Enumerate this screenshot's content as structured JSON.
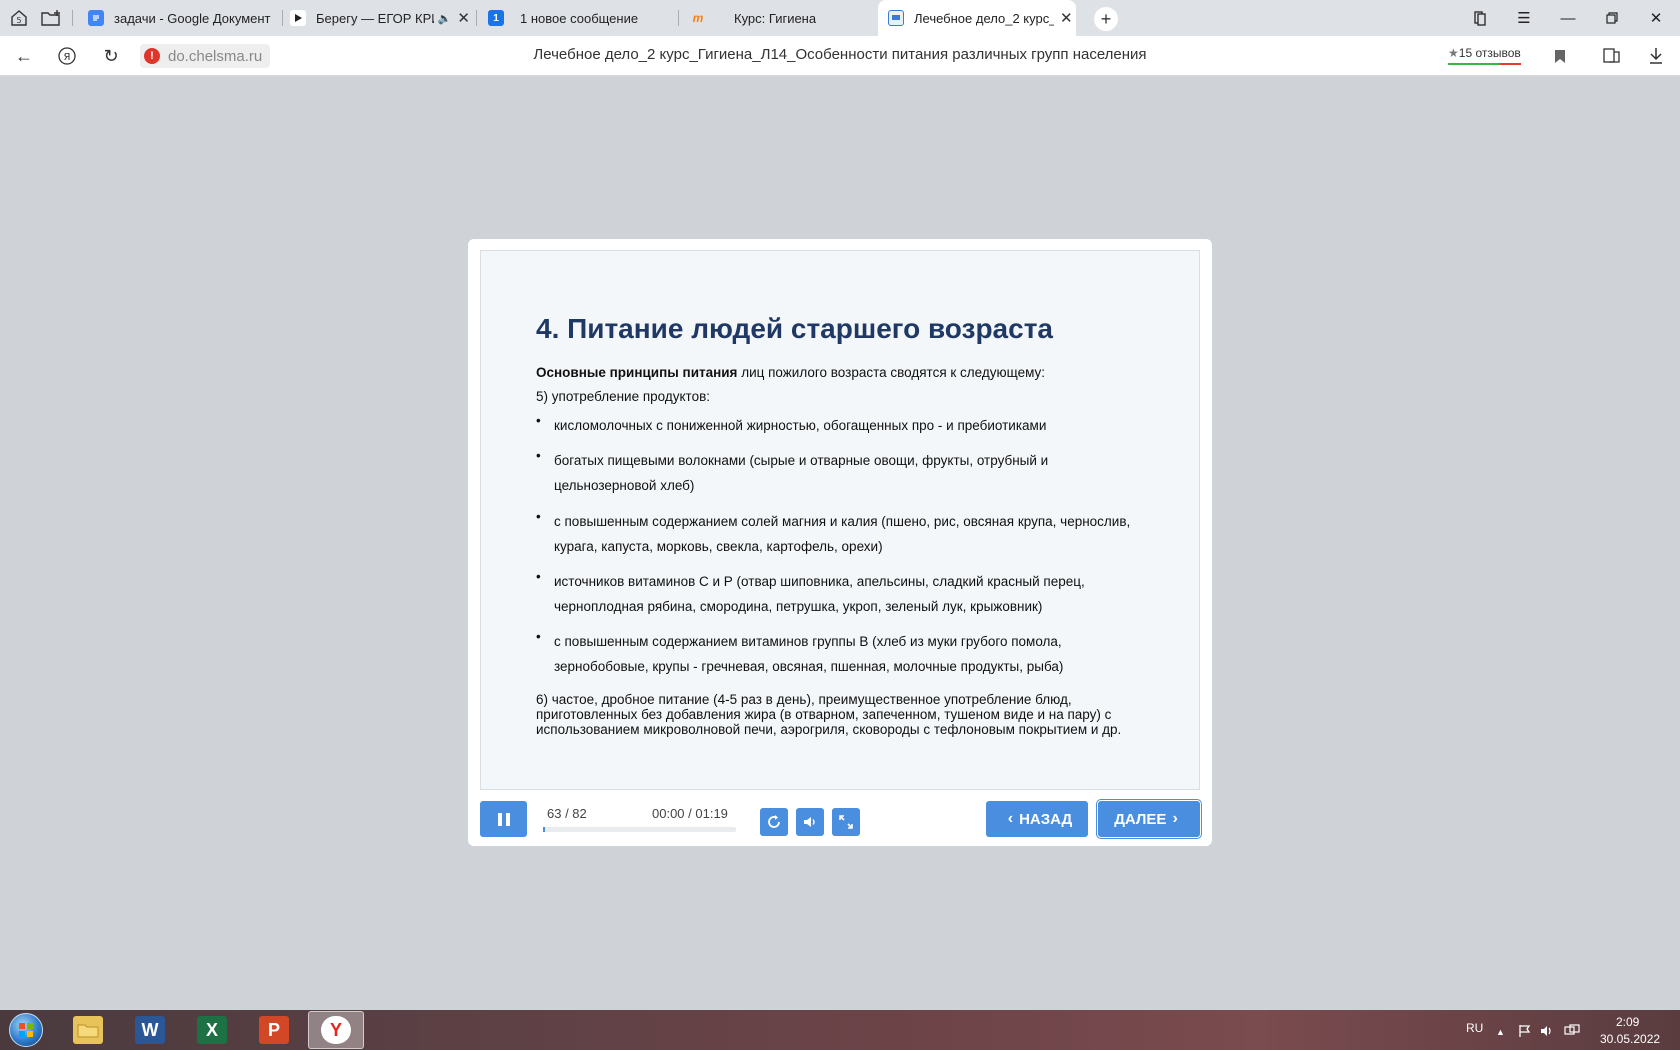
{
  "browser": {
    "tabs": [
      {
        "title": "задачи - Google Документ",
        "favicon": "google-docs-icon",
        "color": "#4285f4"
      },
      {
        "title": "Берегу — ЕГОР КРИД",
        "favicon": "play-icon",
        "color": "#ffffff"
      },
      {
        "title": "1 новое сообщение",
        "favicon": "message-icon",
        "color": "#1a73e8",
        "favicon_text": "1"
      },
      {
        "title": "Курс: Гигиена",
        "favicon": "moodle-icon",
        "color": "#f98012"
      },
      {
        "title": "Лечебное дело_2 курс_",
        "favicon": "slides-icon",
        "color": "#3a7bd5"
      }
    ],
    "address": {
      "url": "do.chelsma.ru",
      "page_title": "Лечебное дело_2 курс_Гигиена_Л14_Особенности питания различных групп населения",
      "reviews": "15 отзывов"
    }
  },
  "slide": {
    "title": "4. Питание людей старшего возраста",
    "intro_bold": "Основные принципы питания",
    "intro_rest": " лиц пожилого возраста сводятся к следующему:",
    "point5": "5) употребление продуктов:",
    "bullets": [
      "кисломолочных с пониженной жирностью, обогащенных про - и пребиотиками",
      "богатых пищевыми волокнами (сырые и отварные овощи, фрукты, отрубный и цельнозерновой хлеб)",
      "с повышенным содержанием солей магния и калия (пшено, рис, овсяная крупа, чернослив, курага, капуста, морковь, свекла, картофель, орехи)",
      "источников витаминов С и Р (отвар шиповника, апельсины, сладкий красный перец, черноплодная рябина, смородина, петрушка, укроп, зеленый лук, крыжовник)",
      "с повышенным содержанием витаминов группы В (хлеб из муки грубого помола, зернобобовые, крупы - гречневая, овсяная, пшенная, молочные продукты, рыба)"
    ],
    "bullet_char": "•",
    "point6": "6) частое, дробное питание (4-5 раз в день), преимущественное употребление блюд, приготовленных без добавления жира (в отварном, запеченном, тушеном виде и на пару) с использованием микроволновой печи, аэрогриля, сковороды с тефлоновым покрытием и др."
  },
  "player": {
    "counter": "63 / 82",
    "time": "00:00 / 01:19",
    "progress_fraction": 0.01,
    "back_label": "НАЗАД",
    "next_label": "ДАЛЕЕ",
    "accent": "#4a8fdf"
  },
  "taskbar": {
    "lang": "RU",
    "time": "2:09",
    "date": "30.05.2022"
  }
}
